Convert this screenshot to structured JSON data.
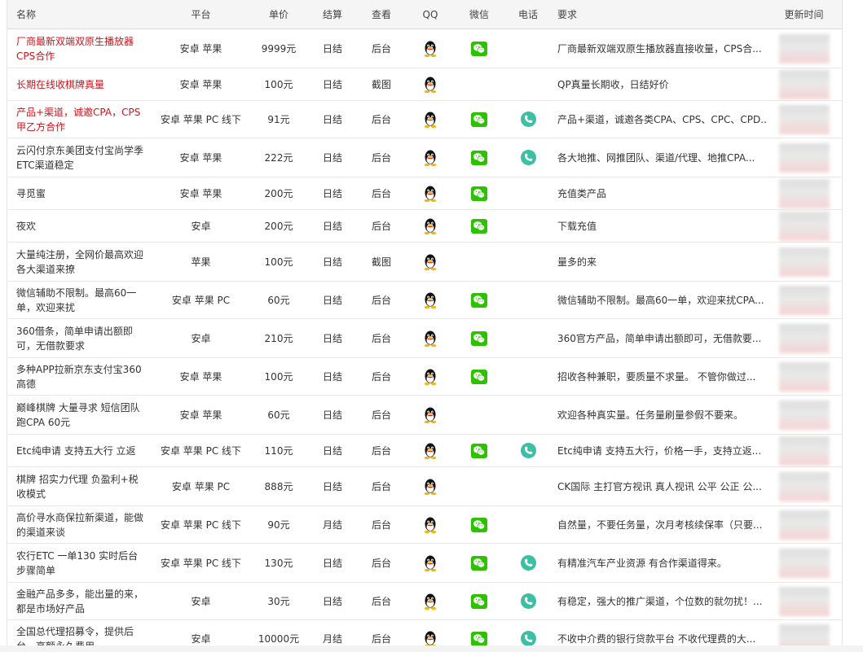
{
  "headers": {
    "name": "名称",
    "platform": "平台",
    "price": "单价",
    "settle": "结算",
    "view": "查看",
    "qq": "QQ",
    "wechat": "微信",
    "phone": "电话",
    "req": "要求",
    "updated": "更新时间"
  },
  "colors": {
    "red_name": "#d0121b",
    "wechat_green": "#2dc100",
    "phone_teal": "#3cc0a5"
  },
  "rows": [
    {
      "name": "厂商最新双端双原生播放器CPS合作",
      "red": true,
      "platform": "安卓 苹果",
      "price": "9999元",
      "settle": "日结",
      "view": "后台",
      "qq": true,
      "wechat": true,
      "phone": false,
      "req": "厂商最新双端双原生播放器直接收量，CPS合..."
    },
    {
      "name": "长期在线收棋牌真量",
      "red": true,
      "platform": "安卓 苹果",
      "price": "100元",
      "settle": "日结",
      "view": "截图",
      "qq": true,
      "wechat": false,
      "phone": false,
      "req": "QP真量长期收，日结好价"
    },
    {
      "name": "产品+渠道，诚邀CPA，CPS甲乙方合作",
      "red": true,
      "platform": "安卓 苹果 PC 线下",
      "price": "91元",
      "settle": "日结",
      "view": "后台",
      "qq": true,
      "wechat": true,
      "phone": true,
      "req": "产品+渠道，诚邀各类CPA、CPS、CPC、CPD..."
    },
    {
      "name": "云闪付京东美团支付宝尚学季ETC渠道稳定",
      "red": false,
      "platform": "安卓 苹果",
      "price": "222元",
      "settle": "日结",
      "view": "后台",
      "qq": true,
      "wechat": true,
      "phone": true,
      "req": "各大地推、网推团队、渠道/代理、地推CPA..."
    },
    {
      "name": "寻觅蜜",
      "red": false,
      "platform": "安卓 苹果",
      "price": "200元",
      "settle": "日结",
      "view": "后台",
      "qq": true,
      "wechat": true,
      "phone": false,
      "req": "充值类产品"
    },
    {
      "name": "夜欢",
      "red": false,
      "platform": "安卓",
      "price": "200元",
      "settle": "日结",
      "view": "后台",
      "qq": true,
      "wechat": true,
      "phone": false,
      "req": "下载充值"
    },
    {
      "name": "大量纯注册，全网价最高欢迎各大渠道来撩",
      "red": false,
      "platform": "苹果",
      "price": "100元",
      "settle": "日结",
      "view": "截图",
      "qq": true,
      "wechat": false,
      "phone": false,
      "req": "量多的来"
    },
    {
      "name": "微信辅助不限制。最高60一单，欢迎来扰",
      "red": false,
      "platform": "安卓 苹果 PC",
      "price": "60元",
      "settle": "日结",
      "view": "后台",
      "qq": true,
      "wechat": true,
      "phone": false,
      "req": "微信辅助不限制。最高60一单，欢迎来扰CPA..."
    },
    {
      "name": "360借条，简单申请出额即可，无借款要求",
      "red": false,
      "platform": "安卓",
      "price": "210元",
      "settle": "日结",
      "view": "后台",
      "qq": true,
      "wechat": true,
      "phone": false,
      "req": "360官方产品，简单申请出额即可，无借款要..."
    },
    {
      "name": "多种APP拉新京东支付宝360高德",
      "red": false,
      "platform": "安卓 苹果",
      "price": "100元",
      "settle": "日结",
      "view": "后台",
      "qq": true,
      "wechat": true,
      "phone": false,
      "req": "招收各种兼职，要质量不求量。 不管你做过..."
    },
    {
      "name": "巅峰棋牌 大量寻求 短信团队跑CPA 60元",
      "red": false,
      "platform": "安卓 苹果",
      "price": "60元",
      "settle": "日结",
      "view": "后台",
      "qq": true,
      "wechat": false,
      "phone": false,
      "req": "欢迎各种真实量。任务量刷量参假不要来。"
    },
    {
      "name": "Etc纯申请 支持五大行 立返",
      "red": false,
      "platform": "安卓 苹果 PC 线下",
      "price": "110元",
      "settle": "日结",
      "view": "后台",
      "qq": true,
      "wechat": true,
      "phone": true,
      "req": "Etc纯申请 支持五大行，价格一手，支持立返..."
    },
    {
      "name": "棋牌 招实力代理 负盈利+税收模式",
      "red": false,
      "platform": "安卓 苹果 PC",
      "price": "888元",
      "settle": "日结",
      "view": "后台",
      "qq": true,
      "wechat": false,
      "phone": false,
      "req": "CK国际 主打官方视讯 真人视讯 公平 公正 公..."
    },
    {
      "name": "高价寻水商保拉新渠道，能做的渠道来谈",
      "red": false,
      "platform": "安卓 苹果 PC 线下",
      "price": "90元",
      "settle": "月结",
      "view": "后台",
      "qq": true,
      "wechat": true,
      "phone": false,
      "req": "自然量，不要任务量，次月考核续保率（只要..."
    },
    {
      "name": "农行ETC 一单130 实时后台步骤简单",
      "red": false,
      "platform": "安卓 苹果 PC 线下",
      "price": "130元",
      "settle": "日结",
      "view": "后台",
      "qq": true,
      "wechat": true,
      "phone": true,
      "req": "有精准汽车产业资源 有合作渠道得来。"
    },
    {
      "name": "金融产品多多，能出量的来，都是市场好产品",
      "red": false,
      "platform": "安卓",
      "price": "30元",
      "settle": "日结",
      "view": "后台",
      "qq": true,
      "wechat": true,
      "phone": true,
      "req": "有稳定，强大的推广渠道，个位数的就勿扰！..."
    },
    {
      "name": "全国总代理招募令，提供后台，高额永久费用",
      "red": false,
      "platform": "安卓",
      "price": "10000元",
      "settle": "月结",
      "view": "后台",
      "qq": true,
      "wechat": true,
      "phone": true,
      "req": "不收中介费的银行贷款平台 不收代理费的大..."
    }
  ]
}
